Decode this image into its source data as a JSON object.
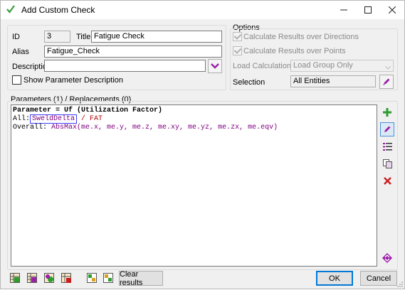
{
  "window": {
    "title": "Add Custom Check"
  },
  "general": {
    "id_label": "ID",
    "id_value": "3",
    "title_label": "Title",
    "title_value": "Fatigue Check",
    "alias_label": "Alias",
    "alias_value": "Fatigue_Check",
    "description_label": "Description",
    "description_value": "",
    "show_param_desc_label": "Show Parameter Description"
  },
  "options": {
    "group_title": "Options",
    "calc_directions_label": "Calculate Results over Directions",
    "calc_points_label": "Calculate Results over Points",
    "load_calc_label": "Load Calculation",
    "load_calc_value": "Load Group Only",
    "selection_label": "Selection",
    "selection_value": "All Entities"
  },
  "params": {
    "header": "Parameters (1) / Replacements (0)",
    "line1": "Parameter = Uf (Utilization Factor)",
    "line2_prefix": "All:",
    "line2_boxed": "SweldDelta",
    "line2_suffix": " / FAT",
    "line3_prefix": "Overall: ",
    "line3_func": "AbsMax",
    "line3_args": "(me.x, me.y, me.z, me.xy, me.yz, me.zx, me.eqv)"
  },
  "footer": {
    "clear_label": "Clear results",
    "ok_label": "OK",
    "cancel_label": "Cancel"
  },
  "colors": {
    "accent": "#0078d7",
    "purple": "#800080",
    "green": "#2e9d2e",
    "red": "#c81e1e"
  }
}
